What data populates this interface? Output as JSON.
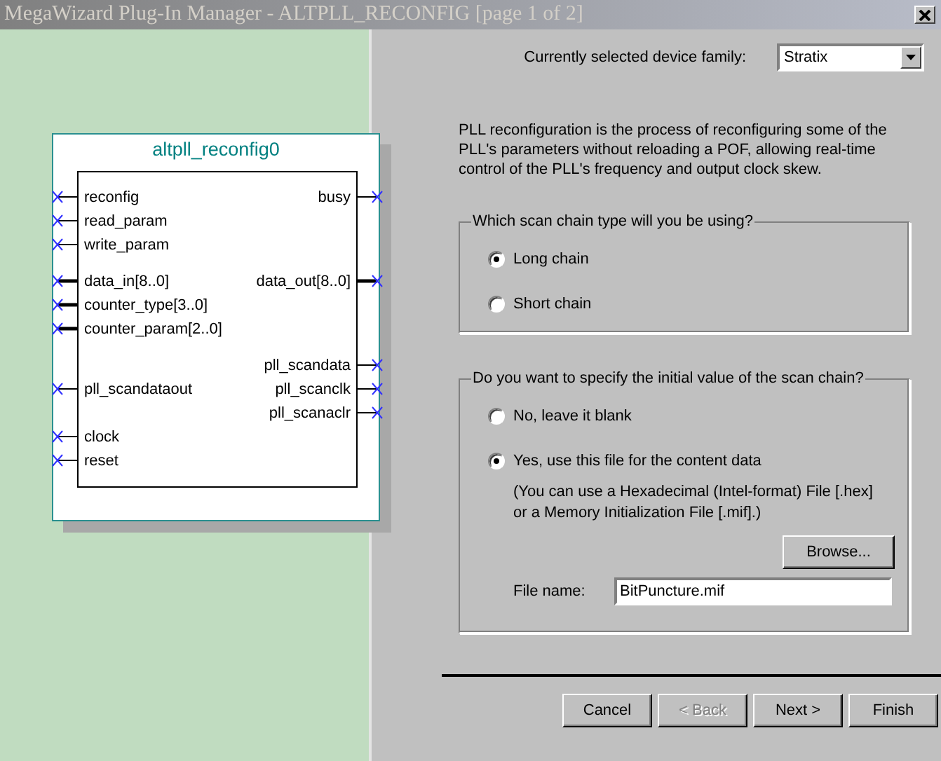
{
  "window": {
    "title": "MegaWizard Plug-In Manager - ALTPLL_RECONFIG [page 1 of 2]"
  },
  "symbol": {
    "name": "altpll_reconfig0",
    "rows": [
      {
        "kind": "ports",
        "left": {
          "label": "reconfig",
          "bus": false
        },
        "right": {
          "label": "busy",
          "bus": false
        }
      },
      {
        "kind": "ports",
        "left": {
          "label": "read_param",
          "bus": false
        }
      },
      {
        "kind": "ports",
        "left": {
          "label": "write_param",
          "bus": false
        }
      },
      {
        "kind": "spacer"
      },
      {
        "kind": "ports",
        "left": {
          "label": "data_in[8..0]",
          "bus": true
        },
        "right": {
          "label": "data_out[8..0]",
          "bus": true
        }
      },
      {
        "kind": "ports",
        "left": {
          "label": "counter_type[3..0]",
          "bus": true
        }
      },
      {
        "kind": "ports",
        "left": {
          "label": "counter_param[2..0]",
          "bus": true
        }
      },
      {
        "kind": "spacer"
      },
      {
        "kind": "ports",
        "right": {
          "label": "pll_scandata",
          "bus": false
        }
      },
      {
        "kind": "ports",
        "left": {
          "label": "pll_scandataout",
          "bus": false
        },
        "right": {
          "label": "pll_scanclk",
          "bus": false
        }
      },
      {
        "kind": "ports",
        "right": {
          "label": "pll_scanaclr",
          "bus": false
        }
      },
      {
        "kind": "ports",
        "left": {
          "label": "clock",
          "bus": false
        }
      },
      {
        "kind": "ports",
        "left": {
          "label": "reset",
          "bus": false
        }
      }
    ]
  },
  "device_family": {
    "label": "Currently selected device family:",
    "value": "Stratix"
  },
  "description": "PLL reconfiguration is the process of reconfiguring some of the PLL's parameters without reloading a POF, allowing real-time control of the PLL's frequency and output clock skew.",
  "scan_chain_group": {
    "legend": "Which scan chain type will you be using?",
    "options": [
      {
        "label": "Long chain",
        "selected": true
      },
      {
        "label": "Short chain",
        "selected": false
      }
    ]
  },
  "initial_value_group": {
    "legend": "Do you want to specify the initial value of the scan chain?",
    "options": [
      {
        "label": "No, leave it blank",
        "selected": false
      },
      {
        "label": "Yes, use this file for the content data",
        "selected": true
      }
    ],
    "note_lines": [
      "(You can use a Hexadecimal (Intel-format) File [.hex]",
      "or a Memory Initialization File [.mif].)"
    ],
    "browse_button": "Browse...",
    "file_name": {
      "label": "File name:",
      "value": "BitPuncture.mif"
    }
  },
  "buttons": [
    {
      "label": "Cancel",
      "disabled": false
    },
    {
      "label": "< Back",
      "disabled": true
    },
    {
      "label": "Next >",
      "disabled": false
    },
    {
      "label": "Finish",
      "disabled": false
    }
  ]
}
